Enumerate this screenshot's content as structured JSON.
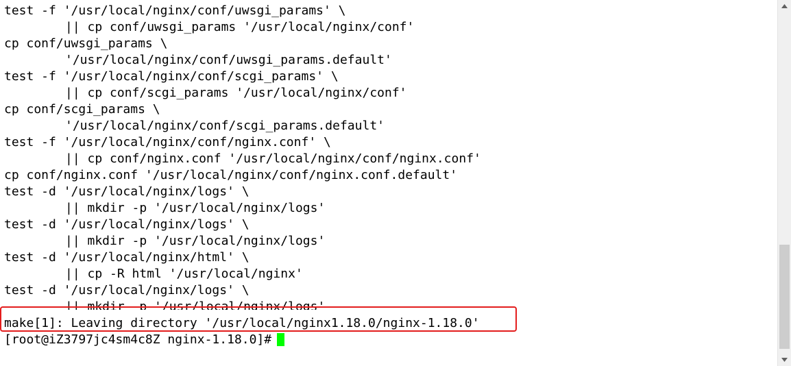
{
  "terminal": {
    "lines": [
      {
        "text": "test -f '/usr/local/nginx/conf/uwsgi_params' \\",
        "indent": false
      },
      {
        "text": "|| cp conf/uwsgi_params '/usr/local/nginx/conf'",
        "indent": true
      },
      {
        "text": "cp conf/uwsgi_params \\",
        "indent": false
      },
      {
        "text": "'/usr/local/nginx/conf/uwsgi_params.default'",
        "indent": true
      },
      {
        "text": "test -f '/usr/local/nginx/conf/scgi_params' \\",
        "indent": false
      },
      {
        "text": "|| cp conf/scgi_params '/usr/local/nginx/conf'",
        "indent": true
      },
      {
        "text": "cp conf/scgi_params \\",
        "indent": false
      },
      {
        "text": "'/usr/local/nginx/conf/scgi_params.default'",
        "indent": true
      },
      {
        "text": "test -f '/usr/local/nginx/conf/nginx.conf' \\",
        "indent": false
      },
      {
        "text": "|| cp conf/nginx.conf '/usr/local/nginx/conf/nginx.conf'",
        "indent": true
      },
      {
        "text": "cp conf/nginx.conf '/usr/local/nginx/conf/nginx.conf.default'",
        "indent": false
      },
      {
        "text": "test -d '/usr/local/nginx/logs' \\",
        "indent": false
      },
      {
        "text": "|| mkdir -p '/usr/local/nginx/logs'",
        "indent": true
      },
      {
        "text": "test -d '/usr/local/nginx/logs' \\",
        "indent": false
      },
      {
        "text": "|| mkdir -p '/usr/local/nginx/logs'",
        "indent": true
      },
      {
        "text": "test -d '/usr/local/nginx/html' \\",
        "indent": false
      },
      {
        "text": "|| cp -R html '/usr/local/nginx'",
        "indent": true
      },
      {
        "text": "test -d '/usr/local/nginx/logs' \\",
        "indent": false
      },
      {
        "text": "|| mkdir -p '/usr/local/nginx/logs'",
        "indent": true,
        "clipped": true
      },
      {
        "text": "make[1]: Leaving directory '/usr/local/nginx1.18.0/nginx-1.18.0'",
        "indent": false
      }
    ],
    "prompt": "[root@iZ3797jc4sm4c8Z nginx-1.18.0]#",
    "colors": {
      "background": "#ffffff",
      "text": "#000000",
      "cursor": "#00ff00",
      "highlight_border": "#e31c1c",
      "scrollbar_track": "#f0f0f0",
      "scrollbar_thumb": "#cdcdcd"
    }
  },
  "scrollbar": {
    "up_icon": "triangle-up-icon",
    "down_icon": "triangle-down-icon",
    "position_fraction": 0.95
  }
}
